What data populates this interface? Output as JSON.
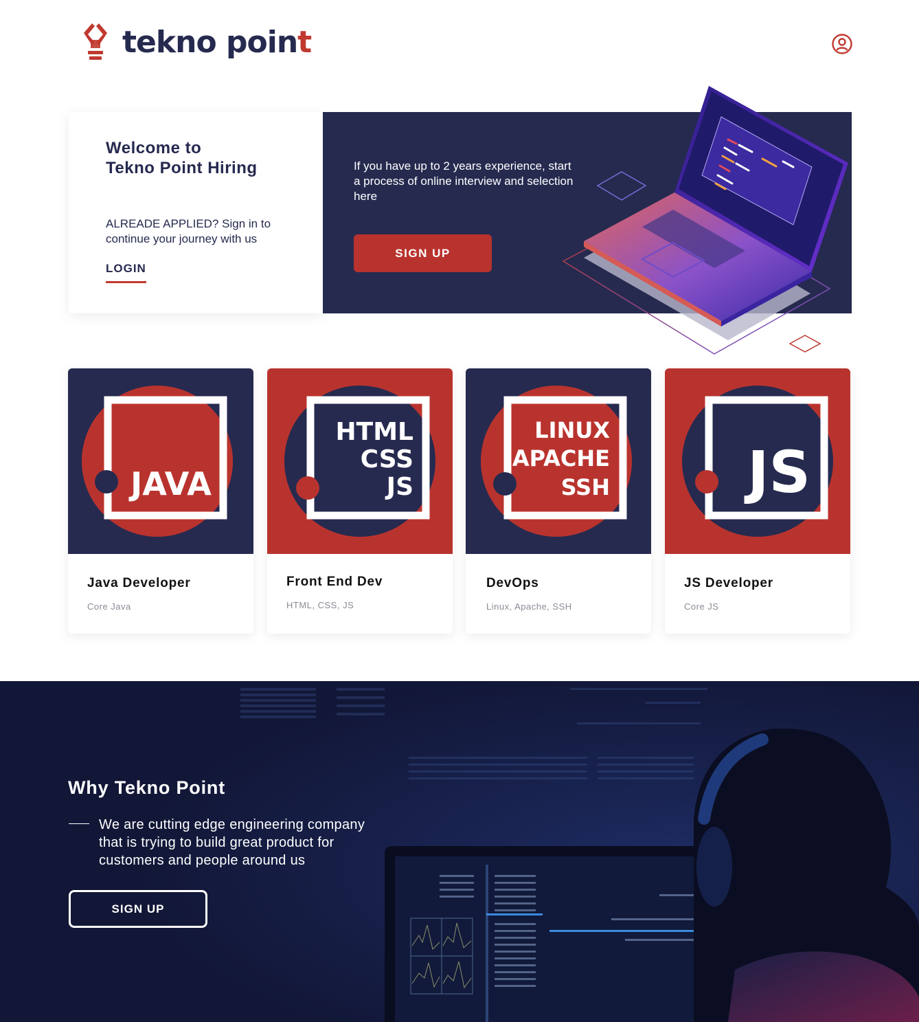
{
  "header": {
    "logo_text_main": "tekno poin",
    "logo_text_accent": "t",
    "profile_icon": "user-circle-icon"
  },
  "hero": {
    "title_line1": "Welcome to",
    "title_line2": "Tekno Point Hiring",
    "subtitle": "ALREADE APPLIED? Sign in to continue your journey with us",
    "login_label": "LOGIN",
    "right_text": "If you have up to 2 years experience, start a process of online interview and selection here",
    "signup_label": "SIGN UP"
  },
  "cards": [
    {
      "badge_lines": [
        "JAVA"
      ],
      "title": "Java Developer",
      "subtitle": "Core Java"
    },
    {
      "badge_lines": [
        "HTML",
        "CSS",
        "JS"
      ],
      "title": "Front End Dev",
      "subtitle": "HTML, CSS, JS"
    },
    {
      "badge_lines": [
        "LINUX",
        "APACHE",
        "SSH"
      ],
      "title": "DevOps",
      "subtitle": "Linux, Apache, SSH"
    },
    {
      "badge_lines": [
        "JS"
      ],
      "title": "JS Developer",
      "subtitle": "Core JS"
    }
  ],
  "why": {
    "title": "Why Tekno Point",
    "text": "We are cutting edge engineering company that is trying to build great product for customers and people around us",
    "signup_label": "SIGN UP"
  },
  "colors": {
    "navy": "#262a4f",
    "red": "#b9332e",
    "dark_bg": "#121737"
  }
}
